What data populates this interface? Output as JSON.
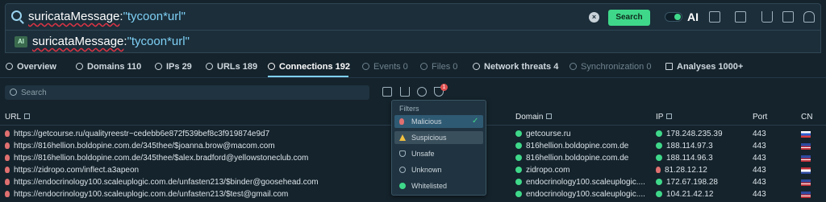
{
  "search": {
    "query_key": "suricataMessage",
    "query_colon": ":",
    "query_value": "\"tycoon*url\"",
    "search_button": "Search",
    "ai_label": "AI"
  },
  "suggestion": {
    "badge": "AI",
    "query_key": "suricataMessage",
    "query_colon": ":",
    "query_value": "\"tycoon*url\""
  },
  "tabs": [
    {
      "label": "Overview"
    },
    {
      "label": "Domains 110"
    },
    {
      "label": "IPs 29"
    },
    {
      "label": "URLs 189"
    },
    {
      "label": "Connections 192"
    },
    {
      "label": "Events 0"
    },
    {
      "label": "Files 0"
    },
    {
      "label": "Network threats 4"
    },
    {
      "label": "Synchronization 0"
    },
    {
      "label": "Analyses 1000+"
    }
  ],
  "toolbar": {
    "search_placeholder": "Search",
    "filter_count": "1"
  },
  "table": {
    "columns": [
      "URL",
      "Domain",
      "IP",
      "Port",
      "CN"
    ],
    "rows": [
      {
        "url": "https://getcourse.ru/qualityreestr~cedebb6e872f539bef8c3f919874e9d7",
        "domain": "getcourse.ru",
        "ip": "178.248.235.39",
        "ip_status": "ok",
        "port": "443",
        "cn": "RU"
      },
      {
        "url": "https://816hellion.boldopine.com.de/345thee/$joanna.brow@macom.com",
        "domain": "816hellion.boldopine.com.de",
        "ip": "188.114.97.3",
        "ip_status": "ok",
        "port": "443",
        "cn": "US"
      },
      {
        "url": "https://816hellion.boldopine.com.de/345thee/$alex.bradford@yellowstoneclub.com",
        "domain": "816hellion.boldopine.com.de",
        "ip": "188.114.96.3",
        "ip_status": "ok",
        "port": "443",
        "cn": "US"
      },
      {
        "url": "https://zidropo.com/inflect.a3apeon",
        "domain": "zidropo.com",
        "ip": "81.28.12.12",
        "ip_status": "bad",
        "port": "443",
        "cn": "NL"
      },
      {
        "url": "https://endocrinology100.scaleuplogic.com.de/unfasten213/$binder@goosehead.com",
        "domain": "endocrinology100.scaleuplogic....",
        "ip": "172.67.198.28",
        "ip_status": "ok",
        "port": "443",
        "cn": "US"
      },
      {
        "url": "https://endocrinology100.scaleuplogic.com.de/unfasten213/$test@gmail.com",
        "domain": "endocrinology100.scaleuplogic....",
        "ip": "104.21.42.12",
        "ip_status": "ok",
        "port": "443",
        "cn": "US"
      }
    ]
  },
  "filters": {
    "title": "Filters",
    "items": [
      {
        "label": "Malicious",
        "selected": true
      },
      {
        "label": "Suspicious",
        "selected": false
      },
      {
        "label": "Unsafe",
        "selected": false
      },
      {
        "label": "Unknown",
        "selected": false
      },
      {
        "label": "Whitelisted",
        "selected": false
      }
    ]
  },
  "colors": {
    "accent": "#3fd88a",
    "malicious": "#e07070",
    "link": "#7fd0f5"
  }
}
